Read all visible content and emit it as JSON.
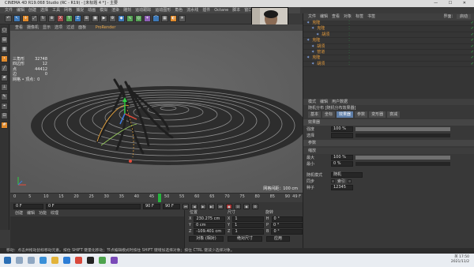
{
  "title_bar": {
    "text": "CINEMA 4D R19.068 Studio (RC - R19) - [未标题 4 *] - 主要"
  },
  "menubar": [
    "文件",
    "编辑",
    "创建",
    "选择",
    "工具",
    "网格",
    "捕捉",
    "动画",
    "模拟",
    "渲染",
    "雕刻",
    "运动跟踪",
    "运动图形",
    "角色",
    "流水线",
    "插件",
    "Octane",
    "脚本",
    "窗口",
    "帮助"
  ],
  "viewport_menu": [
    "查看",
    "摄像机",
    "显示",
    "选项",
    "过滤",
    "面板"
  ],
  "viewport_active_tab": "ProRender",
  "hud": {
    "rows": [
      {
        "label": "三角形",
        "value": "32748"
      },
      {
        "label": "四边形",
        "value": "12"
      },
      {
        "label": "点",
        "value": "44412"
      },
      {
        "label": "边",
        "value": "0"
      }
    ],
    "extra": "网格 • 顶点：0"
  },
  "grid_info": "网格间距：100 cm",
  "timeline": {
    "ticks": [
      "0",
      "5",
      "10",
      "15",
      "20",
      "25",
      "30",
      "35",
      "40",
      "45",
      "50",
      "55",
      "60",
      "65",
      "70",
      "75",
      "80",
      "85",
      "90"
    ],
    "current_frame": 48,
    "end_label": "49 F",
    "cursor_color": "#27b53e"
  },
  "transport": {
    "start": "0 F",
    "current": "0 F",
    "end": "90 F",
    "end2": "90 F"
  },
  "material_tabs": [
    "创建",
    "编辑",
    "功能",
    "纹理"
  ],
  "coords": {
    "headers": [
      "位置",
      "尺寸",
      "旋转"
    ],
    "rows": [
      {
        "axis": "X",
        "pos": "230.275 cm",
        "size_axis": "X",
        "size": "1",
        "rot_axis": "H",
        "rot": "0 °"
      },
      {
        "axis": "Y",
        "pos": "0 cm",
        "size_axis": "Y",
        "size": "1",
        "rot_axis": "P",
        "rot": "0 °"
      },
      {
        "axis": "Z",
        "pos": "-109.401 cm",
        "size_axis": "Z",
        "size": "1",
        "rot_axis": "B",
        "rot": "0 °"
      }
    ],
    "btn_obj": "对象 (相对)",
    "btn_size": "绝对尺寸",
    "btn_apply": "应用"
  },
  "object_manager": {
    "menu": [
      "文件",
      "编辑",
      "查看",
      "对象",
      "标签",
      "书签"
    ],
    "items": [
      {
        "name": "克隆",
        "indent": 0
      },
      {
        "name": "克隆",
        "indent": 1
      },
      {
        "name": "胡须",
        "indent": 2
      },
      {
        "name": "克隆",
        "indent": 0
      },
      {
        "name": "胡须",
        "indent": 1
      },
      {
        "name": "管道",
        "indent": 1
      },
      {
        "name": "克隆",
        "indent": 0
      },
      {
        "name": "胡须",
        "indent": 1
      }
    ],
    "layout_label": "界面：",
    "layout_value": "启动"
  },
  "attributes": {
    "menu": [
      "模式",
      "编辑",
      "用户数据"
    ],
    "title": "随机分布 [随机分布效果器]",
    "tabs": [
      "基本",
      "坐标",
      "效果器",
      "参数",
      "变形器",
      "衰减"
    ],
    "active_tab": "效果器",
    "sections": {
      "effect": "效果器",
      "params": "参数"
    },
    "rows": [
      {
        "label": "强度",
        "value": "100 %",
        "fill": 1.0
      },
      {
        "label": "选择",
        "value": "",
        "fill": 0
      }
    ],
    "scale_label": "缩放",
    "scale_rows": [
      {
        "label": "最大",
        "value": "100 %",
        "fill": 1.0
      },
      {
        "label": "最小",
        "value": "0 %",
        "fill": 0.0
      }
    ],
    "random_mode_label": "随机模式",
    "random_mode_value": "随机",
    "sync_label": "同步",
    "index_label": "索引",
    "seed_label": "种子",
    "seed_value": "12345"
  },
  "status_text": "移动：点击并拖动鼠标移动元素。按住 SHIFT 键量化移动；节点编辑模式时按住 SHIFT 键增加选择对象；按住 CTRL 键减少选择对象。",
  "taskbar": {
    "time": "17:50",
    "date": "2021/11/2",
    "lang": "英"
  }
}
